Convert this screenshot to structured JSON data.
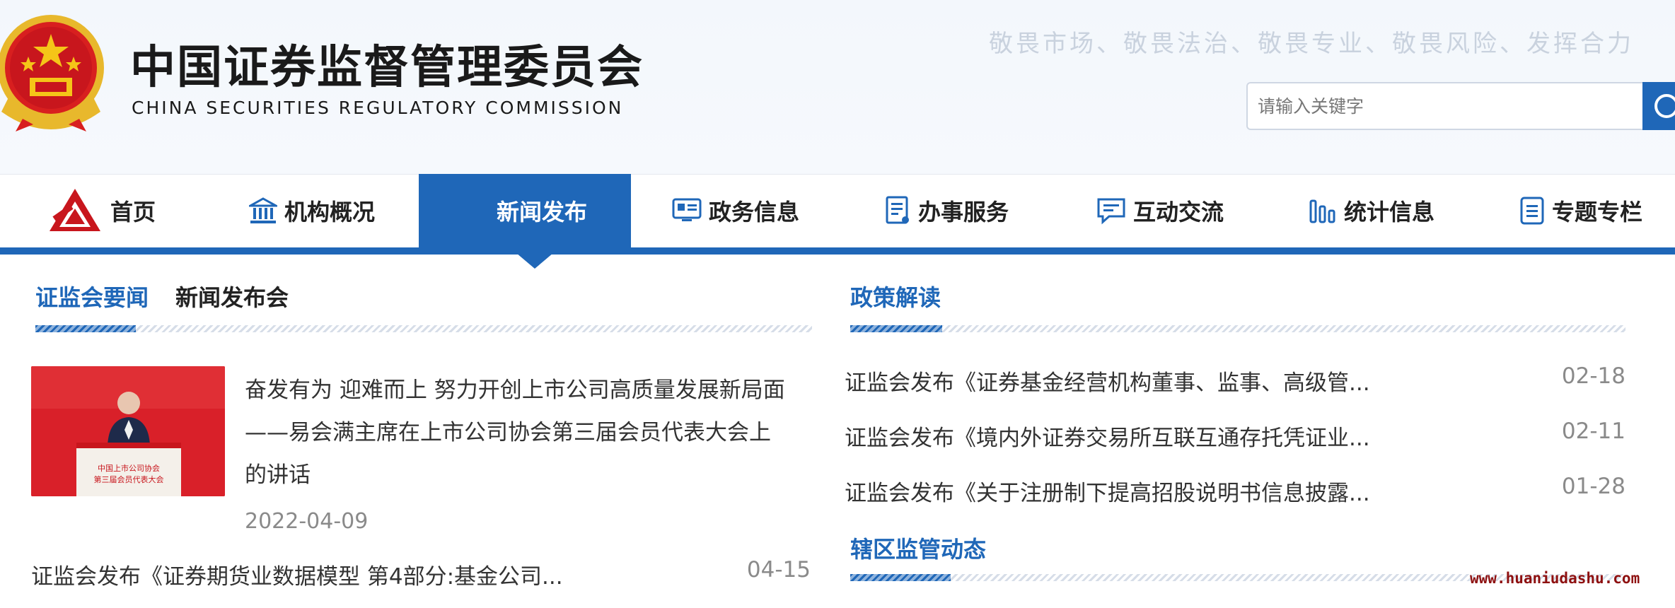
{
  "header": {
    "title": "中国证券监督管理委员会",
    "subtitle": "CHINA SECURITIES REGULATORY COMMISSION",
    "slogan": "敬畏市场、敬畏法治、敬畏专业、敬畏风险、发挥合力",
    "search": {
      "placeholder": "请输入关键字",
      "button_icon": "search-icon"
    },
    "emblem_icon": "national-emblem"
  },
  "nav": {
    "items": [
      {
        "label": "首页",
        "icon": "csrc-logo-icon"
      },
      {
        "label": "机构概况",
        "icon": "building-icon"
      },
      {
        "label": "新闻发布",
        "icon": "",
        "active": true
      },
      {
        "label": "政务信息",
        "icon": "info-board-icon"
      },
      {
        "label": "办事服务",
        "icon": "document-list-icon"
      },
      {
        "label": "互动交流",
        "icon": "chat-icon"
      },
      {
        "label": "统计信息",
        "icon": "bar-chart-icon"
      },
      {
        "label": "专题专栏",
        "icon": "file-icon"
      }
    ],
    "accent_color": "#1f67b8"
  },
  "left": {
    "tabs": [
      "证监会要闻",
      "新闻发布会"
    ],
    "featured": {
      "headline": "奋发有为 迎难而上 努力开创上市公司高质量发展新局面——易会满主席在上市公司协会第三届会员代表大会上的讲话",
      "date": "2022-04-09",
      "photo_caption": [
        "中国上市公司协会",
        "第三届会员代表大会"
      ]
    },
    "list": [
      {
        "title": "证监会发布《证券期货业数据模型 第4部分:基金公司...",
        "date": "04-15"
      }
    ]
  },
  "right": {
    "policy_title": "政策解读",
    "policy_list": [
      {
        "title": "证监会发布《证券基金经营机构董事、监事、高级管...",
        "date": "02-18"
      },
      {
        "title": "证监会发布《境内外证券交易所互联互通存托凭证业...",
        "date": "02-11"
      },
      {
        "title": "证监会发布《关于注册制下提高招股说明书信息披露...",
        "date": "01-28"
      }
    ],
    "regional_title": "辖区监管动态"
  },
  "watermark": "www.huaniudashu.com"
}
